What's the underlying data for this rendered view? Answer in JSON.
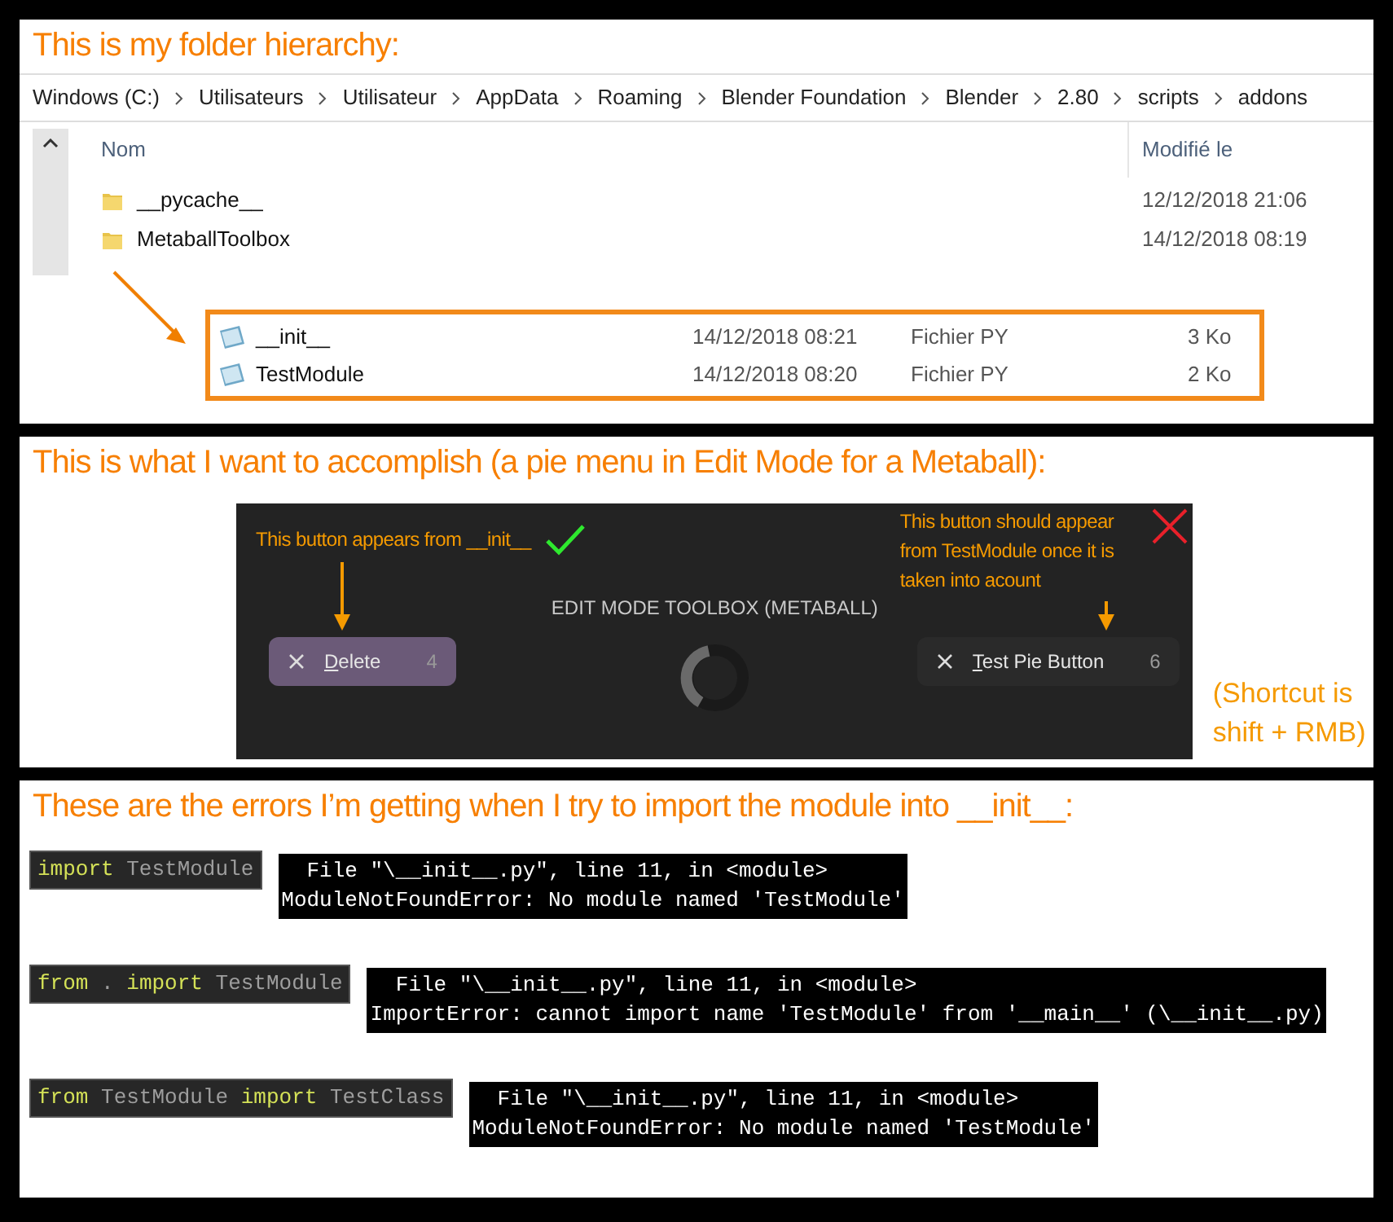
{
  "folder_section": {
    "title": "This is my folder hierarchy:",
    "breadcrumb": [
      "Windows (C:)",
      "Utilisateurs",
      "Utilisateur",
      "AppData",
      "Roaming",
      "Blender Foundation",
      "Blender",
      "2.80",
      "scripts",
      "addons"
    ],
    "columns": [
      "Nom",
      "Modifié le"
    ],
    "folders": [
      {
        "name": "__pycache__",
        "modified": "12/12/2018 21:06"
      },
      {
        "name": "MetaballToolbox",
        "modified": "14/12/2018 08:19"
      }
    ],
    "files": [
      {
        "name": "__init__",
        "modified": "14/12/2018 08:21",
        "type": "Fichier PY",
        "size": "3 Ko"
      },
      {
        "name": "TestModule",
        "modified": "14/12/2018 08:20",
        "type": "Fichier PY",
        "size": "2 Ko"
      }
    ]
  },
  "pie_section": {
    "title": "This is what I want to accomplish (a pie menu in Edit Mode for a Metaball):",
    "menu_title": "EDIT MODE TOOLBOX (METABALL)",
    "items": [
      {
        "note": "This button appears from __init__",
        "kind": "check",
        "label": "Delete",
        "shortcut": "4",
        "selected": true
      },
      {
        "note": "This button should appear from TestModule once it is taken into acount",
        "kind": "cross",
        "label": "Test Pie Button",
        "shortcut": "6",
        "selected": false
      }
    ],
    "shortcut_note": "(Shortcut is shift + RMB)"
  },
  "errors_section": {
    "title": "These are the errors I’m getting when I try to import the module into __init__:",
    "attempts": [
      {
        "code": [
          {
            "kind": "keyword",
            "text": "import"
          },
          {
            "kind": "name",
            "text": "TestModule"
          }
        ],
        "traceback": [
          "  File \"\\__init__.py\", line 11, in <module>",
          "ModuleNotFoundError: No module named 'TestModule'"
        ]
      },
      {
        "code": [
          {
            "kind": "keyword",
            "text": "from"
          },
          {
            "kind": "name",
            "text": "."
          },
          {
            "kind": "keyword",
            "text": "import"
          },
          {
            "kind": "name",
            "text": "TestModule"
          }
        ],
        "traceback": [
          "  File \"\\__init__.py\", line 11, in <module>",
          "ImportError: cannot import name 'TestModule' from '__main__' (\\__init__.py)"
        ]
      },
      {
        "code": [
          {
            "kind": "keyword",
            "text": "from"
          },
          {
            "kind": "name",
            "text": "TestModule"
          },
          {
            "kind": "keyword",
            "text": "import"
          },
          {
            "kind": "name",
            "text": "TestClass"
          }
        ],
        "traceback": [
          "  File \"\\__init__.py\", line 11, in <module>",
          "ModuleNotFoundError: No module named 'TestModule'"
        ]
      }
    ]
  }
}
